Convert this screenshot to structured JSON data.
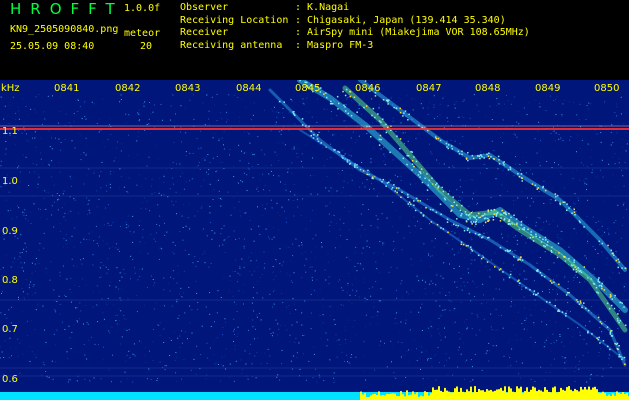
{
  "header": {
    "app_title": "HROFFT",
    "version": "1.0.0f",
    "filename": "KN9_2505090840.png",
    "datetime": "25.05.09 08:40",
    "meteor_label": "meteor",
    "meteor_count": "20"
  },
  "meta": [
    {
      "key": "Observer",
      "value": ": K.Nagai"
    },
    {
      "key": "Receiving Location",
      "value": ": Chigasaki, Japan (139.414 35.340)"
    },
    {
      "key": "Receiver",
      "value": ": AirSpy mini (Miakejima VOR 108.65MHz)"
    },
    {
      "key": "Receiving antenna",
      "value": ": Maspro FM-3"
    }
  ],
  "spectrogram": {
    "y_unit": "kHz",
    "y_ticks": [
      "1.1",
      "1.0",
      "0.9",
      "0.8",
      "0.7",
      "0.6"
    ],
    "x_ticks": [
      "0841",
      "0842",
      "0843",
      "0844",
      "0845",
      "0846",
      "0847",
      "0848",
      "0849",
      "0850"
    ],
    "colors": {
      "background": "#00167a",
      "trace": "#ff2020",
      "level": "#ffff00",
      "noise": "#00e0ff"
    }
  }
}
